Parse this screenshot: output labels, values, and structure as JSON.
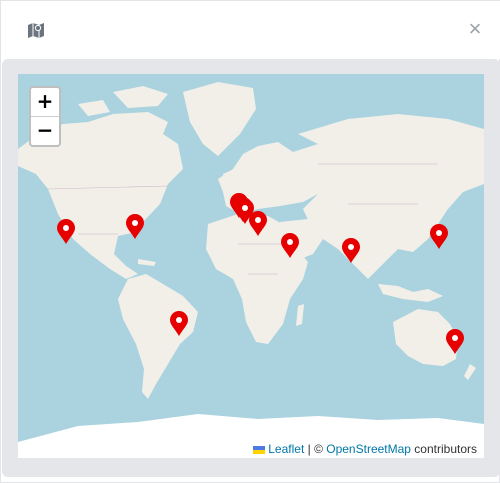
{
  "header": {
    "icon": "map-icon",
    "close_label": "×"
  },
  "map": {
    "zoom_in_label": "+",
    "zoom_out_label": "−",
    "attribution": {
      "leaflet_label": "Leaflet",
      "separator": " | © ",
      "osm_label": "OpenStreetMap",
      "suffix": " contributors"
    },
    "colors": {
      "water": "#aad3df",
      "land": "#f2efe9",
      "ice": "#ffffff",
      "marker": "#e60000"
    },
    "markers": [
      {
        "name": "marker-los-angeles"
      },
      {
        "name": "marker-new-york"
      },
      {
        "name": "marker-rio-de-janeiro"
      },
      {
        "name": "marker-western-europe-1"
      },
      {
        "name": "marker-western-europe-2"
      },
      {
        "name": "marker-western-europe-3"
      },
      {
        "name": "marker-eastern-mediterranean"
      },
      {
        "name": "marker-middle-east"
      },
      {
        "name": "marker-india"
      },
      {
        "name": "marker-japan"
      },
      {
        "name": "marker-sydney"
      }
    ]
  }
}
